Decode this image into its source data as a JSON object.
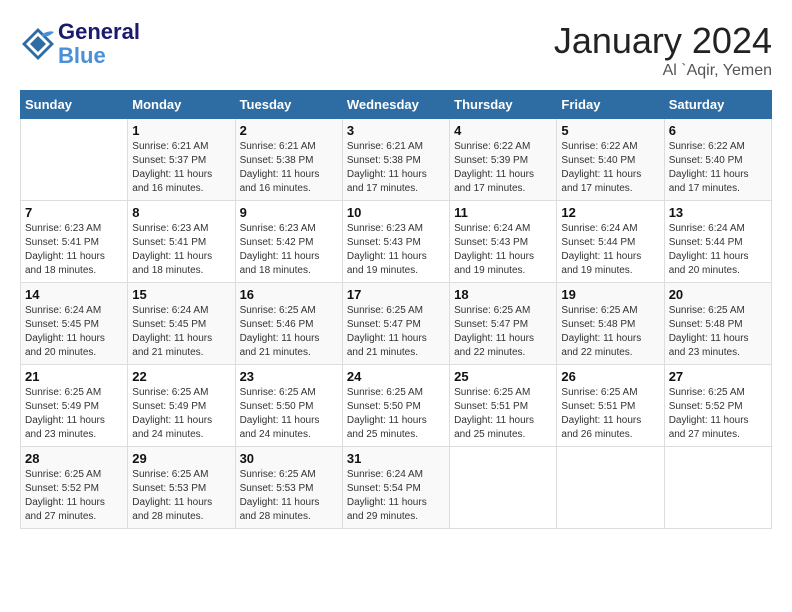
{
  "header": {
    "logo_line1": "General",
    "logo_line2": "Blue",
    "month_year": "January 2024",
    "location": "Al `Aqir, Yemen"
  },
  "weekdays": [
    "Sunday",
    "Monday",
    "Tuesday",
    "Wednesday",
    "Thursday",
    "Friday",
    "Saturday"
  ],
  "weeks": [
    [
      {
        "day": "",
        "sunrise": "",
        "sunset": "",
        "daylight": ""
      },
      {
        "day": "1",
        "sunrise": "Sunrise: 6:21 AM",
        "sunset": "Sunset: 5:37 PM",
        "daylight": "Daylight: 11 hours and 16 minutes."
      },
      {
        "day": "2",
        "sunrise": "Sunrise: 6:21 AM",
        "sunset": "Sunset: 5:38 PM",
        "daylight": "Daylight: 11 hours and 16 minutes."
      },
      {
        "day": "3",
        "sunrise": "Sunrise: 6:21 AM",
        "sunset": "Sunset: 5:38 PM",
        "daylight": "Daylight: 11 hours and 17 minutes."
      },
      {
        "day": "4",
        "sunrise": "Sunrise: 6:22 AM",
        "sunset": "Sunset: 5:39 PM",
        "daylight": "Daylight: 11 hours and 17 minutes."
      },
      {
        "day": "5",
        "sunrise": "Sunrise: 6:22 AM",
        "sunset": "Sunset: 5:40 PM",
        "daylight": "Daylight: 11 hours and 17 minutes."
      },
      {
        "day": "6",
        "sunrise": "Sunrise: 6:22 AM",
        "sunset": "Sunset: 5:40 PM",
        "daylight": "Daylight: 11 hours and 17 minutes."
      }
    ],
    [
      {
        "day": "7",
        "sunrise": "Sunrise: 6:23 AM",
        "sunset": "Sunset: 5:41 PM",
        "daylight": "Daylight: 11 hours and 18 minutes."
      },
      {
        "day": "8",
        "sunrise": "Sunrise: 6:23 AM",
        "sunset": "Sunset: 5:41 PM",
        "daylight": "Daylight: 11 hours and 18 minutes."
      },
      {
        "day": "9",
        "sunrise": "Sunrise: 6:23 AM",
        "sunset": "Sunset: 5:42 PM",
        "daylight": "Daylight: 11 hours and 18 minutes."
      },
      {
        "day": "10",
        "sunrise": "Sunrise: 6:23 AM",
        "sunset": "Sunset: 5:43 PM",
        "daylight": "Daylight: 11 hours and 19 minutes."
      },
      {
        "day": "11",
        "sunrise": "Sunrise: 6:24 AM",
        "sunset": "Sunset: 5:43 PM",
        "daylight": "Daylight: 11 hours and 19 minutes."
      },
      {
        "day": "12",
        "sunrise": "Sunrise: 6:24 AM",
        "sunset": "Sunset: 5:44 PM",
        "daylight": "Daylight: 11 hours and 19 minutes."
      },
      {
        "day": "13",
        "sunrise": "Sunrise: 6:24 AM",
        "sunset": "Sunset: 5:44 PM",
        "daylight": "Daylight: 11 hours and 20 minutes."
      }
    ],
    [
      {
        "day": "14",
        "sunrise": "Sunrise: 6:24 AM",
        "sunset": "Sunset: 5:45 PM",
        "daylight": "Daylight: 11 hours and 20 minutes."
      },
      {
        "day": "15",
        "sunrise": "Sunrise: 6:24 AM",
        "sunset": "Sunset: 5:45 PM",
        "daylight": "Daylight: 11 hours and 21 minutes."
      },
      {
        "day": "16",
        "sunrise": "Sunrise: 6:25 AM",
        "sunset": "Sunset: 5:46 PM",
        "daylight": "Daylight: 11 hours and 21 minutes."
      },
      {
        "day": "17",
        "sunrise": "Sunrise: 6:25 AM",
        "sunset": "Sunset: 5:47 PM",
        "daylight": "Daylight: 11 hours and 21 minutes."
      },
      {
        "day": "18",
        "sunrise": "Sunrise: 6:25 AM",
        "sunset": "Sunset: 5:47 PM",
        "daylight": "Daylight: 11 hours and 22 minutes."
      },
      {
        "day": "19",
        "sunrise": "Sunrise: 6:25 AM",
        "sunset": "Sunset: 5:48 PM",
        "daylight": "Daylight: 11 hours and 22 minutes."
      },
      {
        "day": "20",
        "sunrise": "Sunrise: 6:25 AM",
        "sunset": "Sunset: 5:48 PM",
        "daylight": "Daylight: 11 hours and 23 minutes."
      }
    ],
    [
      {
        "day": "21",
        "sunrise": "Sunrise: 6:25 AM",
        "sunset": "Sunset: 5:49 PM",
        "daylight": "Daylight: 11 hours and 23 minutes."
      },
      {
        "day": "22",
        "sunrise": "Sunrise: 6:25 AM",
        "sunset": "Sunset: 5:49 PM",
        "daylight": "Daylight: 11 hours and 24 minutes."
      },
      {
        "day": "23",
        "sunrise": "Sunrise: 6:25 AM",
        "sunset": "Sunset: 5:50 PM",
        "daylight": "Daylight: 11 hours and 24 minutes."
      },
      {
        "day": "24",
        "sunrise": "Sunrise: 6:25 AM",
        "sunset": "Sunset: 5:50 PM",
        "daylight": "Daylight: 11 hours and 25 minutes."
      },
      {
        "day": "25",
        "sunrise": "Sunrise: 6:25 AM",
        "sunset": "Sunset: 5:51 PM",
        "daylight": "Daylight: 11 hours and 25 minutes."
      },
      {
        "day": "26",
        "sunrise": "Sunrise: 6:25 AM",
        "sunset": "Sunset: 5:51 PM",
        "daylight": "Daylight: 11 hours and 26 minutes."
      },
      {
        "day": "27",
        "sunrise": "Sunrise: 6:25 AM",
        "sunset": "Sunset: 5:52 PM",
        "daylight": "Daylight: 11 hours and 27 minutes."
      }
    ],
    [
      {
        "day": "28",
        "sunrise": "Sunrise: 6:25 AM",
        "sunset": "Sunset: 5:52 PM",
        "daylight": "Daylight: 11 hours and 27 minutes."
      },
      {
        "day": "29",
        "sunrise": "Sunrise: 6:25 AM",
        "sunset": "Sunset: 5:53 PM",
        "daylight": "Daylight: 11 hours and 28 minutes."
      },
      {
        "day": "30",
        "sunrise": "Sunrise: 6:25 AM",
        "sunset": "Sunset: 5:53 PM",
        "daylight": "Daylight: 11 hours and 28 minutes."
      },
      {
        "day": "31",
        "sunrise": "Sunrise: 6:24 AM",
        "sunset": "Sunset: 5:54 PM",
        "daylight": "Daylight: 11 hours and 29 minutes."
      },
      {
        "day": "",
        "sunrise": "",
        "sunset": "",
        "daylight": ""
      },
      {
        "day": "",
        "sunrise": "",
        "sunset": "",
        "daylight": ""
      },
      {
        "day": "",
        "sunrise": "",
        "sunset": "",
        "daylight": ""
      }
    ]
  ]
}
